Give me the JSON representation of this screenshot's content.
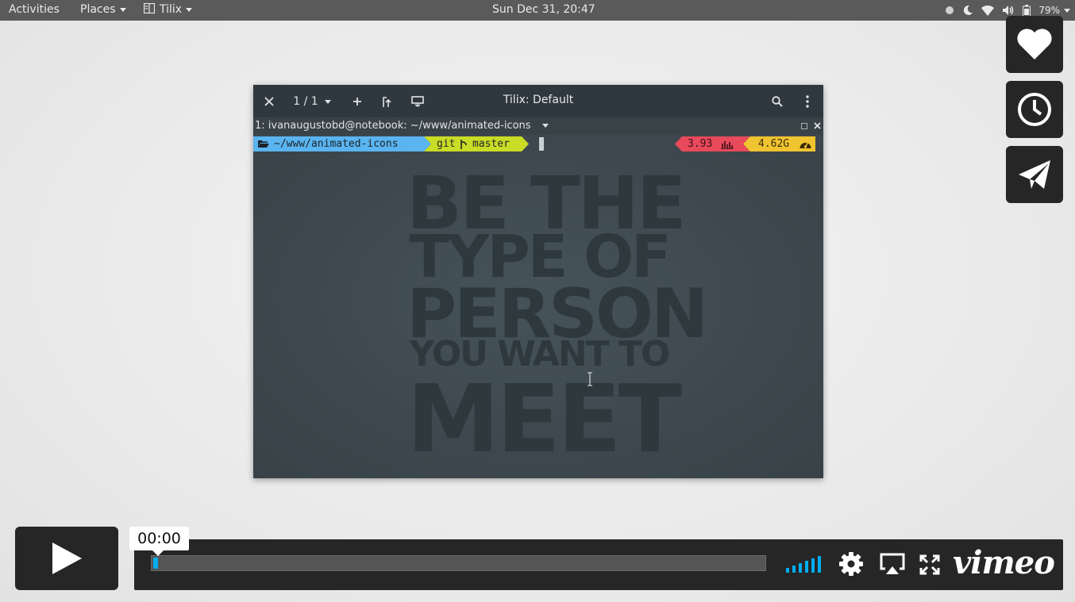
{
  "topbar": {
    "activities": "Activities",
    "places": "Places",
    "app": "Tilix",
    "clock": "Sun Dec 31, 20:47",
    "battery_percent": "79%"
  },
  "tilix": {
    "window_title": "Tilix: Default",
    "session_counter": "1 / 1",
    "terminal_title": "1: ivanaugustobd@notebook: ~/www/animated-icons",
    "prompt": {
      "path": "~/www/animated-icons",
      "vcs": "git",
      "branch": "master",
      "load": "3.93",
      "memory": "4.62G"
    },
    "poster_lines": [
      "BE THE",
      "TYPE OF",
      "PERSON",
      "YOU WANT TO",
      "MEET"
    ]
  },
  "player": {
    "time": "00:00",
    "progress": 0.005,
    "logo": "vimeo",
    "accent_color": "#00adef",
    "side_buttons": [
      "heart-icon",
      "clock-icon",
      "send-icon"
    ],
    "controls": [
      "volume-icon",
      "gear-icon",
      "airplay-icon",
      "fullscreen-icon"
    ]
  },
  "colors": {
    "prompt_path_bg": "#5ab4f0",
    "prompt_git_bg": "#c9dc26",
    "prompt_load_bg": "#e8495b",
    "prompt_mem_bg": "#f0c430"
  }
}
